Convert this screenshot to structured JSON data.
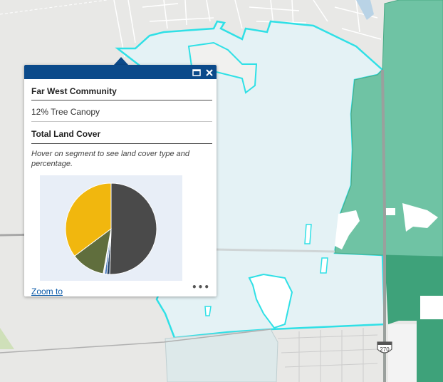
{
  "popup": {
    "title": "Far West Community",
    "canopy": "12% Tree Canopy",
    "section": "Total Land Cover",
    "hint": "Hover on segment to see land cover type and percentage.",
    "zoom_label": "Zoom to",
    "more_label": "•••"
  },
  "map": {
    "highway_label": "270",
    "colors": {
      "base": "#e6e6e6",
      "selected_fill": "#e4f2f5",
      "selected_outline": "#2fe0e6",
      "canopy_green": "#6fc3a4",
      "dark_green": "#3ea27a",
      "popup_header": "#0b4a8a"
    }
  },
  "chart_data": {
    "type": "pie",
    "slices": [
      {
        "value": 50.5,
        "color": "#4a4a4a"
      },
      {
        "value": 1.0,
        "color": "#1f3b5e"
      },
      {
        "value": 0.8,
        "color": "#4b7bbf"
      },
      {
        "value": 0.5,
        "color": "#e6e6e6"
      },
      {
        "value": 12,
        "color": "#606e3d"
      },
      {
        "value": 35.2,
        "color": "#f1b70e"
      }
    ],
    "start_angle_deg": 90,
    "direction": "clockwise"
  }
}
